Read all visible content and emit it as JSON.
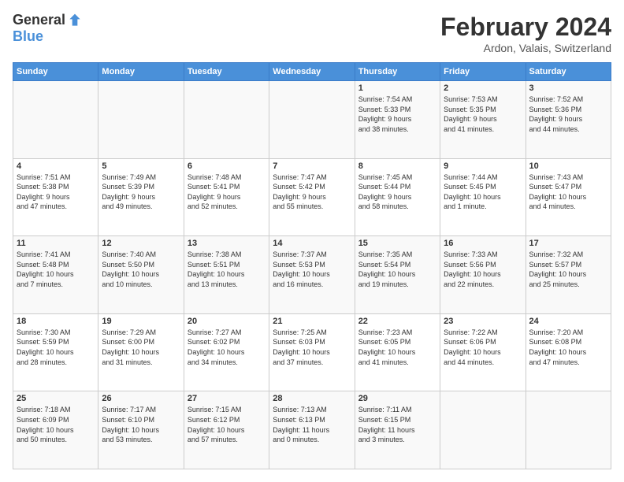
{
  "header": {
    "logo_line1": "General",
    "logo_line2": "Blue",
    "month_year": "February 2024",
    "location": "Ardon, Valais, Switzerland"
  },
  "days_of_week": [
    "Sunday",
    "Monday",
    "Tuesday",
    "Wednesday",
    "Thursday",
    "Friday",
    "Saturday"
  ],
  "weeks": [
    [
      {
        "day": "",
        "info": ""
      },
      {
        "day": "",
        "info": ""
      },
      {
        "day": "",
        "info": ""
      },
      {
        "day": "",
        "info": ""
      },
      {
        "day": "1",
        "info": "Sunrise: 7:54 AM\nSunset: 5:33 PM\nDaylight: 9 hours\nand 38 minutes."
      },
      {
        "day": "2",
        "info": "Sunrise: 7:53 AM\nSunset: 5:35 PM\nDaylight: 9 hours\nand 41 minutes."
      },
      {
        "day": "3",
        "info": "Sunrise: 7:52 AM\nSunset: 5:36 PM\nDaylight: 9 hours\nand 44 minutes."
      }
    ],
    [
      {
        "day": "4",
        "info": "Sunrise: 7:51 AM\nSunset: 5:38 PM\nDaylight: 9 hours\nand 47 minutes."
      },
      {
        "day": "5",
        "info": "Sunrise: 7:49 AM\nSunset: 5:39 PM\nDaylight: 9 hours\nand 49 minutes."
      },
      {
        "day": "6",
        "info": "Sunrise: 7:48 AM\nSunset: 5:41 PM\nDaylight: 9 hours\nand 52 minutes."
      },
      {
        "day": "7",
        "info": "Sunrise: 7:47 AM\nSunset: 5:42 PM\nDaylight: 9 hours\nand 55 minutes."
      },
      {
        "day": "8",
        "info": "Sunrise: 7:45 AM\nSunset: 5:44 PM\nDaylight: 9 hours\nand 58 minutes."
      },
      {
        "day": "9",
        "info": "Sunrise: 7:44 AM\nSunset: 5:45 PM\nDaylight: 10 hours\nand 1 minute."
      },
      {
        "day": "10",
        "info": "Sunrise: 7:43 AM\nSunset: 5:47 PM\nDaylight: 10 hours\nand 4 minutes."
      }
    ],
    [
      {
        "day": "11",
        "info": "Sunrise: 7:41 AM\nSunset: 5:48 PM\nDaylight: 10 hours\nand 7 minutes."
      },
      {
        "day": "12",
        "info": "Sunrise: 7:40 AM\nSunset: 5:50 PM\nDaylight: 10 hours\nand 10 minutes."
      },
      {
        "day": "13",
        "info": "Sunrise: 7:38 AM\nSunset: 5:51 PM\nDaylight: 10 hours\nand 13 minutes."
      },
      {
        "day": "14",
        "info": "Sunrise: 7:37 AM\nSunset: 5:53 PM\nDaylight: 10 hours\nand 16 minutes."
      },
      {
        "day": "15",
        "info": "Sunrise: 7:35 AM\nSunset: 5:54 PM\nDaylight: 10 hours\nand 19 minutes."
      },
      {
        "day": "16",
        "info": "Sunrise: 7:33 AM\nSunset: 5:56 PM\nDaylight: 10 hours\nand 22 minutes."
      },
      {
        "day": "17",
        "info": "Sunrise: 7:32 AM\nSunset: 5:57 PM\nDaylight: 10 hours\nand 25 minutes."
      }
    ],
    [
      {
        "day": "18",
        "info": "Sunrise: 7:30 AM\nSunset: 5:59 PM\nDaylight: 10 hours\nand 28 minutes."
      },
      {
        "day": "19",
        "info": "Sunrise: 7:29 AM\nSunset: 6:00 PM\nDaylight: 10 hours\nand 31 minutes."
      },
      {
        "day": "20",
        "info": "Sunrise: 7:27 AM\nSunset: 6:02 PM\nDaylight: 10 hours\nand 34 minutes."
      },
      {
        "day": "21",
        "info": "Sunrise: 7:25 AM\nSunset: 6:03 PM\nDaylight: 10 hours\nand 37 minutes."
      },
      {
        "day": "22",
        "info": "Sunrise: 7:23 AM\nSunset: 6:05 PM\nDaylight: 10 hours\nand 41 minutes."
      },
      {
        "day": "23",
        "info": "Sunrise: 7:22 AM\nSunset: 6:06 PM\nDaylight: 10 hours\nand 44 minutes."
      },
      {
        "day": "24",
        "info": "Sunrise: 7:20 AM\nSunset: 6:08 PM\nDaylight: 10 hours\nand 47 minutes."
      }
    ],
    [
      {
        "day": "25",
        "info": "Sunrise: 7:18 AM\nSunset: 6:09 PM\nDaylight: 10 hours\nand 50 minutes."
      },
      {
        "day": "26",
        "info": "Sunrise: 7:17 AM\nSunset: 6:10 PM\nDaylight: 10 hours\nand 53 minutes."
      },
      {
        "day": "27",
        "info": "Sunrise: 7:15 AM\nSunset: 6:12 PM\nDaylight: 10 hours\nand 57 minutes."
      },
      {
        "day": "28",
        "info": "Sunrise: 7:13 AM\nSunset: 6:13 PM\nDaylight: 11 hours\nand 0 minutes."
      },
      {
        "day": "29",
        "info": "Sunrise: 7:11 AM\nSunset: 6:15 PM\nDaylight: 11 hours\nand 3 minutes."
      },
      {
        "day": "",
        "info": ""
      },
      {
        "day": "",
        "info": ""
      }
    ]
  ]
}
